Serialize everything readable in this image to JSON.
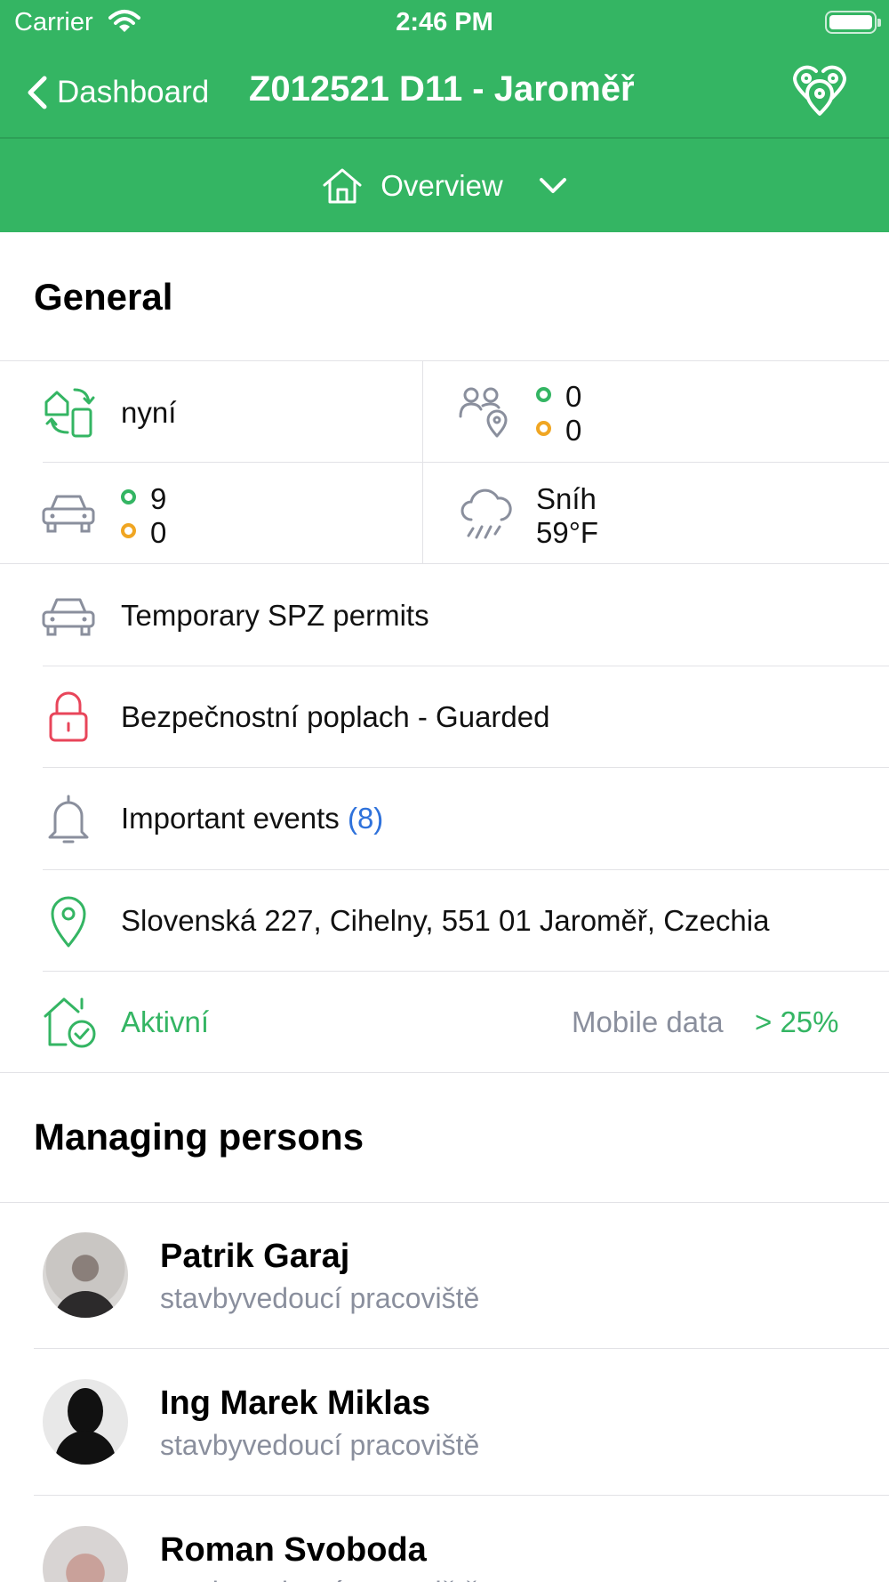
{
  "status_bar": {
    "carrier": "Carrier",
    "time": "2:46 PM"
  },
  "nav": {
    "back_label": "Dashboard",
    "title": "Z012521 D11 - Jaroměř"
  },
  "section_selector": {
    "label": "Overview"
  },
  "general": {
    "title": "General",
    "sync_status": "nyní",
    "people": {
      "green": "0",
      "orange": "0"
    },
    "vehicles": {
      "green": "9",
      "orange": "0"
    },
    "weather": {
      "condition": "Sníh",
      "temperature": "59°F"
    },
    "temp_permits": "Temporary SPZ permits",
    "security": "Bezpečnostní poplach - Guarded",
    "events": {
      "label": "Important events",
      "count": "(8)"
    },
    "address": "Slovenská 227, Cihelny, 551 01 Jaroměř, Czechia",
    "state": {
      "label": "Aktivní",
      "connection_label": "Mobile data",
      "signal": "> 25%"
    }
  },
  "managing_persons": {
    "title": "Managing persons",
    "people": [
      {
        "name": "Patrik Garaj",
        "role": "stavbyvedoucí pracoviště"
      },
      {
        "name": "Ing Marek Miklas",
        "role": "stavbyvedoucí pracoviště"
      },
      {
        "name": "Roman Svoboda",
        "role": "stavbyvedoucí pracoviště"
      }
    ]
  },
  "colors": {
    "brand_green": "#34b563",
    "warning_orange": "#f0a623",
    "alert_red": "#e8455a",
    "link_blue": "#2f72db",
    "muted_grey": "#8a8f9d"
  }
}
